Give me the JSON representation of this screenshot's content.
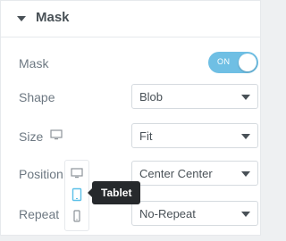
{
  "section": {
    "title": "Mask"
  },
  "mask": {
    "label": "Mask",
    "toggle_text": "ON"
  },
  "shape": {
    "label": "Shape",
    "value": "Blob"
  },
  "size": {
    "label": "Size",
    "value": "Fit"
  },
  "position": {
    "label": "Position",
    "value": "Center Center"
  },
  "repeat": {
    "label": "Repeat",
    "value": "No-Repeat"
  },
  "tooltip": {
    "text": "Tablet"
  },
  "colors": {
    "accent": "#6fbfe4",
    "active_device": "#5bc0e8",
    "tooltip_bg": "#26292c"
  }
}
